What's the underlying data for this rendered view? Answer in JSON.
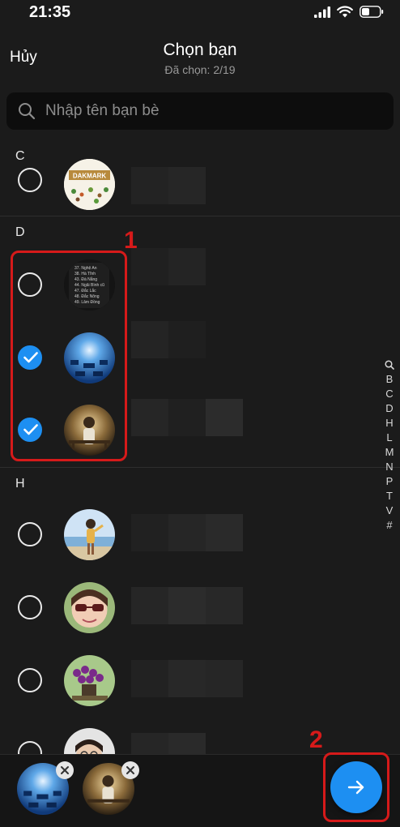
{
  "status_bar": {
    "time": "21:35"
  },
  "header": {
    "cancel_label": "Hủy",
    "title": "Chọn bạn",
    "subtitle": "Đã chọn: 2/19"
  },
  "search": {
    "placeholder": "Nhập tên bạn bè",
    "value": ""
  },
  "sections": [
    {
      "letter": "C"
    },
    {
      "letter": "D"
    },
    {
      "letter": "H"
    }
  ],
  "friends": [
    {
      "section": "C",
      "selected": false,
      "avatar": "dakmark-logo-avatar",
      "avatar_text": "DAKMARK"
    },
    {
      "section": "D",
      "selected": false,
      "avatar": "text-list-avatar",
      "avatar_text": "37. Nghệ An\n38. Hà Tĩnh\n43. Đà Nẵng\n44. Ngãi Bình cũ\n47. Đắc Lắc\n48. Đắc Nông\n49. Lâm Đồng"
    },
    {
      "section": "D",
      "selected": true,
      "avatar": "blue-hall-avatar",
      "avatar_text": ""
    },
    {
      "section": "D",
      "selected": true,
      "avatar": "cafe-person-avatar",
      "avatar_text": ""
    },
    {
      "section": "H",
      "selected": false,
      "avatar": "beach-person-avatar",
      "avatar_text": ""
    },
    {
      "section": "H",
      "selected": false,
      "avatar": "sunglasses-person-avatar",
      "avatar_text": ""
    },
    {
      "section": "H",
      "selected": false,
      "avatar": "orchid-flowers-avatar",
      "avatar_text": ""
    },
    {
      "section": "H",
      "selected": false,
      "avatar": "glasses-person-avatar",
      "avatar_text": ""
    }
  ],
  "alpha_index": [
    "B",
    "C",
    "D",
    "H",
    "L",
    "M",
    "N",
    "P",
    "T",
    "V",
    "#"
  ],
  "selected_chips": [
    {
      "avatar": "blue-hall-avatar"
    },
    {
      "avatar": "cafe-person-avatar"
    }
  ],
  "annotations": [
    {
      "label": "1",
      "color": "#d61a1a"
    },
    {
      "label": "2",
      "color": "#d61a1a"
    }
  ],
  "colors": {
    "accent": "#1d8ff2",
    "background": "#1b1b1b",
    "annotation": "#d61a1a"
  }
}
